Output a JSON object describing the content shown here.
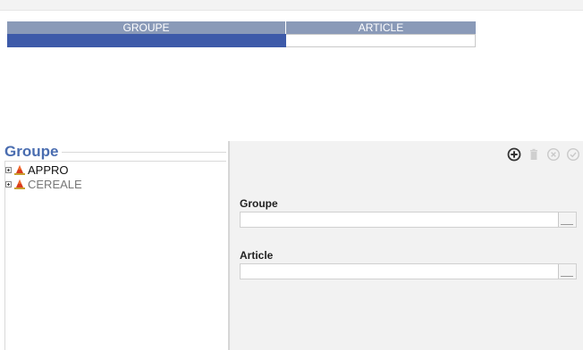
{
  "grid": {
    "columns": [
      "GROUPE",
      "ARTICLE"
    ],
    "rows": [
      [
        "",
        ""
      ]
    ]
  },
  "tree_panel": {
    "title": "Groupe",
    "items": [
      {
        "label": "APPRO"
      },
      {
        "label": "CEREALE"
      }
    ]
  },
  "form": {
    "toolbar": {
      "add_icon": "plus-circle-icon",
      "delete_icon": "trash-icon",
      "cancel_icon": "x-circle-icon",
      "confirm_icon": "check-circle-icon"
    },
    "fields": [
      {
        "label": "Groupe",
        "value": ""
      },
      {
        "label": "Article",
        "value": ""
      }
    ]
  },
  "colors": {
    "header_bg": "#8a9ab8",
    "selected_row": "#3d5aa9",
    "title_blue": "#4a6db0"
  }
}
